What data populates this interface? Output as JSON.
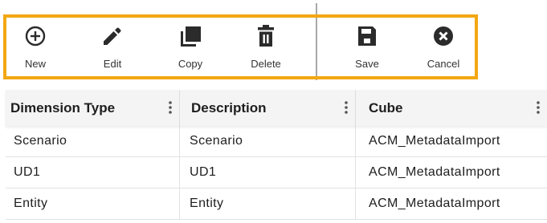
{
  "toolbar": {
    "new_label": "New",
    "edit_label": "Edit",
    "copy_label": "Copy",
    "delete_label": "Delete",
    "save_label": "Save",
    "cancel_label": "Cancel",
    "highlight_color": "#f3a712",
    "icon_color": "#2b2b2b"
  },
  "grid": {
    "columns": [
      "Dimension Type",
      "Description",
      "Cube"
    ],
    "rows": [
      [
        "Scenario",
        "Scenario",
        "ACM_MetadataImport"
      ],
      [
        "UD1",
        "UD1",
        "ACM_MetadataImport"
      ],
      [
        "Entity",
        "Entity",
        "ACM_MetadataImport"
      ]
    ]
  }
}
